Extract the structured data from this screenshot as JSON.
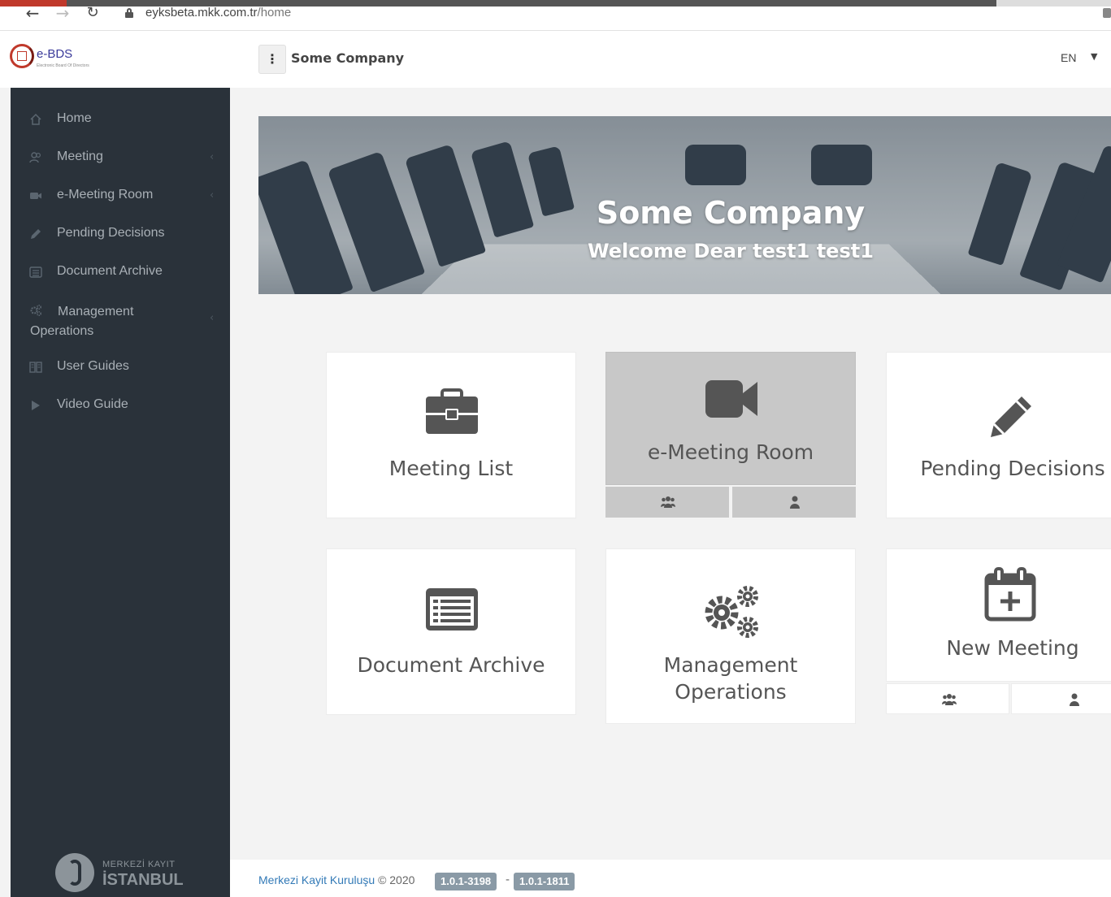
{
  "browser": {
    "url_host": "eyksbeta.mkk.com.tr",
    "url_path": "/home"
  },
  "header": {
    "logo_text": "e-BDS",
    "logo_tagline": "Electronic Board Of Directors",
    "company": "Some Company",
    "language": "EN"
  },
  "sidebar": {
    "items": [
      {
        "label": "Home",
        "icon": "home-icon"
      },
      {
        "label": "Meeting",
        "icon": "users-icon"
      },
      {
        "label": "e-Meeting Room",
        "icon": "video-camera-icon"
      },
      {
        "label": "Pending Decisions",
        "icon": "pencil-icon"
      },
      {
        "label": "Document Archive",
        "icon": "list-icon"
      },
      {
        "label": "Management",
        "label2": "Operations",
        "icon": "gears-icon"
      },
      {
        "label": "User Guides",
        "icon": "book-icon"
      },
      {
        "label": "Video Guide",
        "icon": "play-icon"
      }
    ],
    "footer_logo_line1": "MERKEZİ KAYIT",
    "footer_logo_line2": "İSTANBUL"
  },
  "hero": {
    "title": "Some Company",
    "welcome": "Welcome Dear test1 test1"
  },
  "cards": {
    "meeting_list": "Meeting List",
    "emeeting_room": "e-Meeting Room",
    "pending_decisions": "Pending Decisions",
    "document_archive": "Document Archive",
    "management_line1": "Management",
    "management_line2": "Operations",
    "new_meeting": "New Meeting"
  },
  "footer": {
    "org": "Merkezi Kayit Kuruluşu",
    "copyright": "© 2020",
    "version1": "1.0.1-3198",
    "separator": "-",
    "version2": "1.0.1-1811"
  },
  "colors": {
    "sidebar_bg": "#2a323a",
    "card_active": "#c8c8c8",
    "icon": "#555555",
    "badge": "#8a9aa6"
  }
}
